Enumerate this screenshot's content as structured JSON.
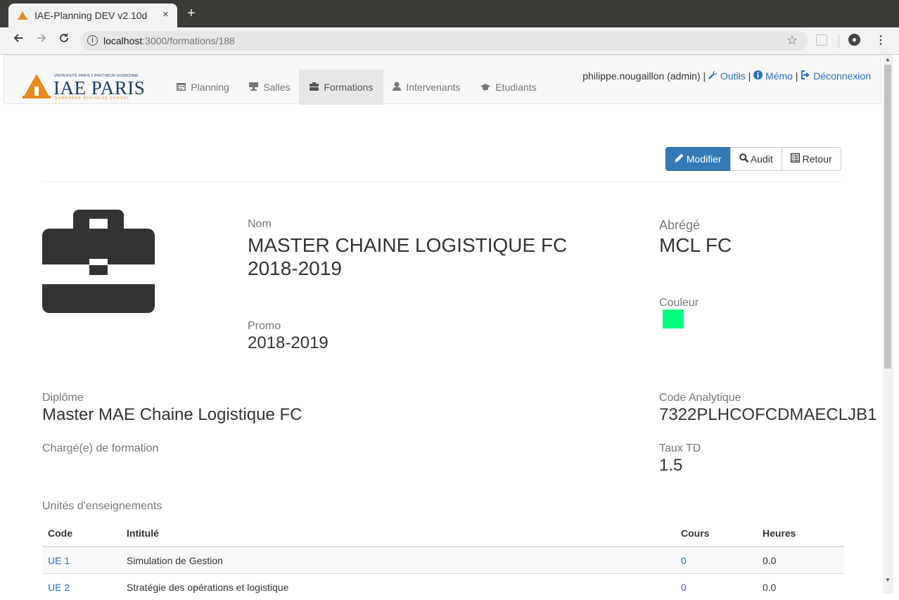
{
  "browser": {
    "tab_title": "IAE-Planning DEV v2.10d",
    "close_glyph": "×",
    "new_tab_glyph": "+",
    "url_host": "localhost",
    "url_rest": ":3000/formations/188"
  },
  "logo": {
    "small_text": "UNIVERSITÉ PARIS 1 PANTHÉON SORBONNE",
    "main_text": "IAE PARIS",
    "sub_text": "SORBONNE BUSINESS SCHOOL"
  },
  "nav": {
    "items": [
      {
        "label": "Planning",
        "icon": "calendar-icon"
      },
      {
        "label": "Salles",
        "icon": "easel-icon"
      },
      {
        "label": "Formations",
        "icon": "briefcase-icon"
      },
      {
        "label": "Intervenants",
        "icon": "user-icon"
      },
      {
        "label": "Etudiants",
        "icon": "graduation-cap-icon"
      }
    ],
    "active": "Formations",
    "user": "philippe.nougaillon (admin) |",
    "outils": "Outils",
    "memo": "Mémo",
    "deconnexion": "Déconnexion",
    "pipe": "|"
  },
  "actions": {
    "modifier": "Modifier",
    "audit": "Audit",
    "retour": "Retour"
  },
  "formation": {
    "nom_label": "Nom",
    "nom_line1": "MASTER CHAINE LOGISTIQUE FC",
    "nom_line2": "2018-2019",
    "abrege_label": "Abrégé",
    "abrege": "MCL FC",
    "couleur_label": "Couleur",
    "couleur": "#00ff7f",
    "promo_label": "Promo",
    "promo": "2018-2019",
    "diplome_label": "Diplôme",
    "diplome": "Master MAE Chaine Logistique FC",
    "code_label": "Code Analytique",
    "code": "7322PLHCOFCDMAECLJB1",
    "charge_label": "Chargé(e) de formation",
    "taux_label": "Taux TD",
    "taux": "1.5",
    "ue_title": "Unités d'enseignements"
  },
  "ue_table": {
    "headers": [
      "Code",
      "Intitulé",
      "Cours",
      "Heures"
    ],
    "rows": [
      {
        "code": "UE 1",
        "intitule": "Simulation de Gestion",
        "cours": "0",
        "heures": "0.0"
      },
      {
        "code": "UE 2",
        "intitule": "Stratégie des opérations et logistique",
        "cours": "0",
        "heures": "0.0"
      }
    ]
  }
}
